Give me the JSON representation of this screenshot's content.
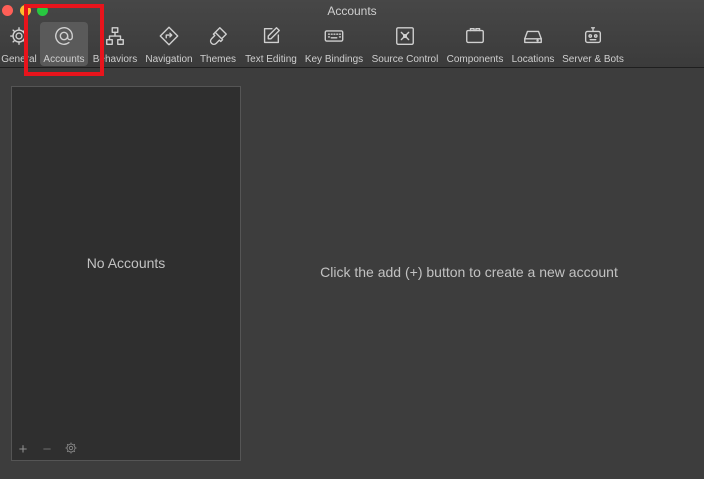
{
  "window": {
    "title": "Accounts"
  },
  "toolbar": {
    "items": [
      {
        "label": "General",
        "icon": "gear-icon"
      },
      {
        "label": "Accounts",
        "icon": "at-icon",
        "selected": true
      },
      {
        "label": "Behaviors",
        "icon": "hierarchy-icon"
      },
      {
        "label": "Navigation",
        "icon": "navigation-icon"
      },
      {
        "label": "Themes",
        "icon": "brush-icon"
      },
      {
        "label": "Text Editing",
        "icon": "edit-icon"
      },
      {
        "label": "Key Bindings",
        "icon": "keyboard-icon"
      },
      {
        "label": "Source Control",
        "icon": "source-control-icon"
      },
      {
        "label": "Components",
        "icon": "components-icon"
      },
      {
        "label": "Locations",
        "icon": "drive-icon"
      },
      {
        "label": "Server & Bots",
        "icon": "robot-icon"
      }
    ]
  },
  "sidebar": {
    "empty_text": "No Accounts",
    "add_label": "+",
    "remove_label": "−"
  },
  "main": {
    "message": "Click the add (+) button to create a new account"
  },
  "colors": {
    "highlight": "#e8141c",
    "selected_bg": "#5a5a5a"
  }
}
